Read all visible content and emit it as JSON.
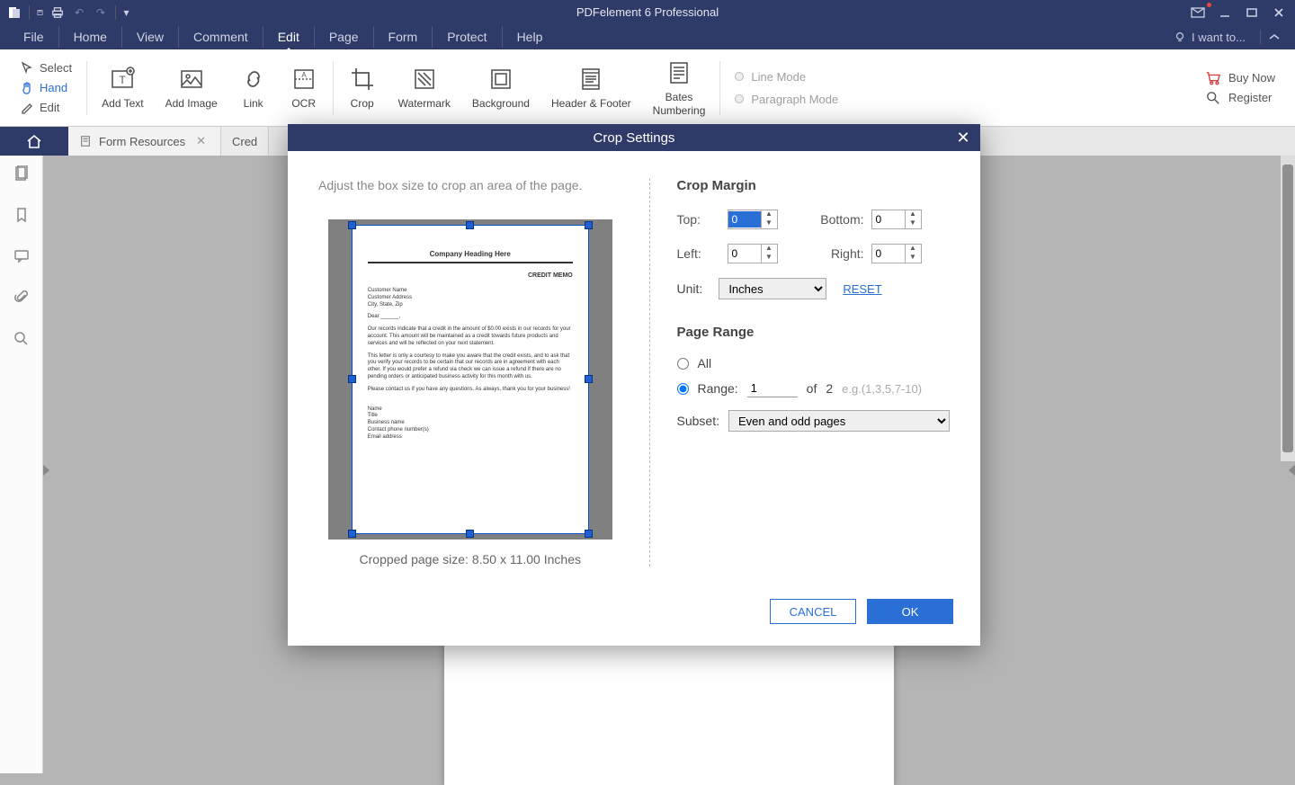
{
  "app": {
    "title": "PDFelement 6 Professional",
    "iwant": "I want to..."
  },
  "menu": {
    "file": "File",
    "home": "Home",
    "view": "View",
    "comment": "Comment",
    "edit": "Edit",
    "page": "Page",
    "form": "Form",
    "protect": "Protect",
    "help": "Help"
  },
  "ribbon": {
    "select": "Select",
    "hand": "Hand",
    "edittool": "Edit",
    "addtext": "Add Text",
    "addimage": "Add Image",
    "link": "Link",
    "ocr": "OCR",
    "crop": "Crop",
    "watermark": "Watermark",
    "background": "Background",
    "headerfooter": "Header & Footer",
    "bates": "Bates\nNumbering",
    "linemode": "Line Mode",
    "paramode": "Paragraph Mode",
    "buynow": "Buy Now",
    "register": "Register"
  },
  "tabs": {
    "tab1": "Form Resources",
    "tab2": "Cred"
  },
  "sidebar": {},
  "dialog": {
    "title": "Crop Settings",
    "hint": "Adjust the box size to crop an area of the page.",
    "preview_heading": "Company Heading Here",
    "preview_credit": "CREDIT MEMO",
    "page_size": "Cropped page size: 8.50 x 11.00 Inches",
    "crop_margin": "Crop Margin",
    "top": "Top:",
    "bottom": "Bottom:",
    "left": "Left:",
    "right": "Right:",
    "unit": "Unit:",
    "top_v": "0",
    "bottom_v": "0",
    "left_v": "0",
    "right_v": "0",
    "unit_sel": "Inches",
    "reset": "RESET",
    "page_range": "Page Range",
    "all": "All",
    "range": "Range:",
    "range_v": "1",
    "of": "of",
    "total": "2",
    "eg": "e.g.(1,3,5,7-10)",
    "subset": "Subset:",
    "subset_sel": "Even and odd pages",
    "cancel": "CANCEL",
    "ok": "OK"
  }
}
